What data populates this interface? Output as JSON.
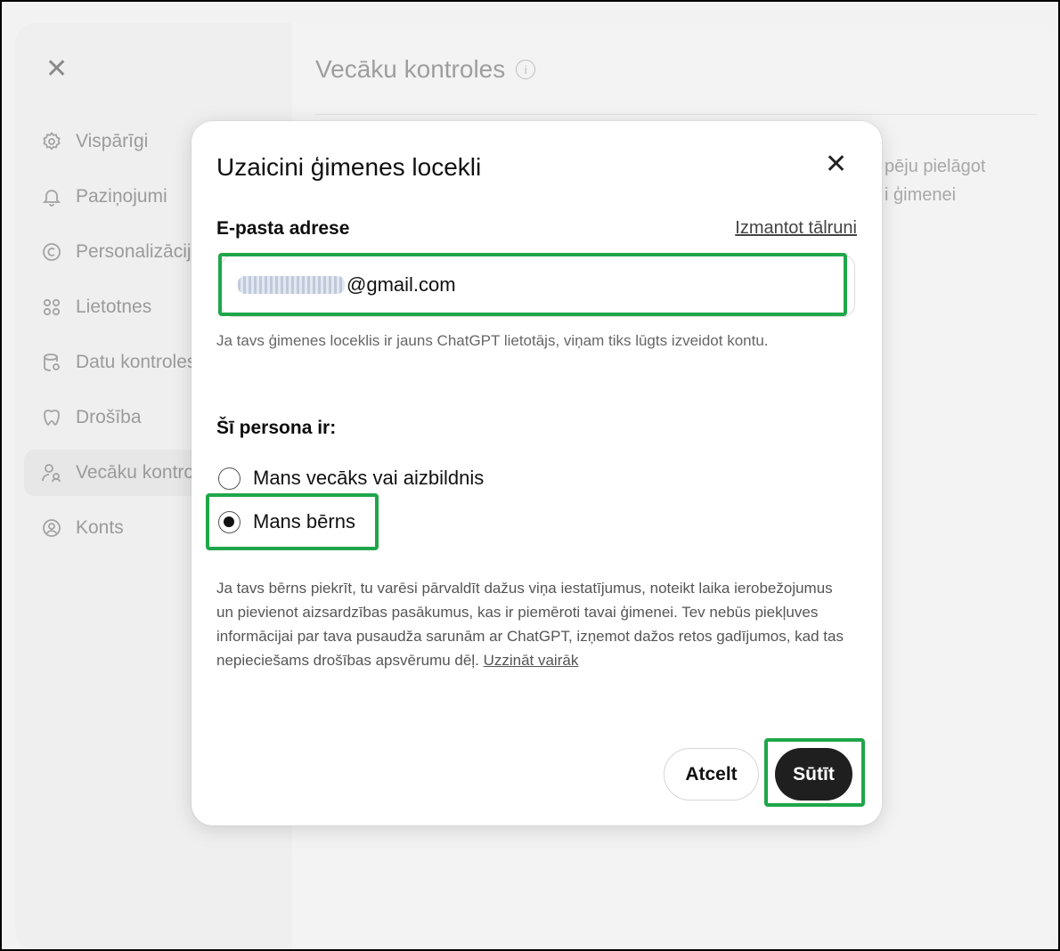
{
  "background": {
    "close_icon": "close-icon",
    "sidebar": {
      "items": [
        {
          "label": "Vispārīgi",
          "icon": "gear-icon",
          "active": false
        },
        {
          "label": "Paziņojumi",
          "icon": "bell-icon",
          "active": false
        },
        {
          "label": "Personalizācija",
          "icon": "personalization-icon",
          "active": false
        },
        {
          "label": "Lietotnes",
          "icon": "apps-grid-icon",
          "active": false
        },
        {
          "label": "Datu kontroles",
          "icon": "database-icon",
          "active": false
        },
        {
          "label": "Drošība",
          "icon": "shield-icon",
          "active": false
        },
        {
          "label": "Vecāku kontroles",
          "icon": "parental-icon",
          "active": true
        },
        {
          "label": "Konts",
          "icon": "account-icon",
          "active": false
        }
      ]
    },
    "main": {
      "title": "Vecāku kontroles",
      "text_line1": "pēju pielāgot",
      "text_line2": "i ģimenei"
    }
  },
  "dialog": {
    "title": "Uzaicini ģimenes locekli",
    "email_label": "E-pasta adrese",
    "use_phone_link": "Izmantot tālruni",
    "email_value_visible": "@gmail.com",
    "email_hint": "Ja tavs ģimenes loceklis ir jauns ChatGPT lietotājs, viņam tiks lūgts izveidot kontu.",
    "persona_label": "Šī persona ir:",
    "options": [
      {
        "label": "Mans vecāks vai aizbildnis",
        "checked": false
      },
      {
        "label": "Mans bērns",
        "checked": true
      }
    ],
    "description": "Ja tavs bērns piekrīt, tu varēsi pārvaldīt dažus viņa iestatījumus, noteikt laika ierobežojumus un pievienot aizsardzības pasākumus, kas ir piemēroti tavai ģimenei. Tev nebūs piekļuves informācijai par tava pusaudža sarunām ar ChatGPT, izņemot dažos retos gadījumos, kad tas nepieciešams drošības apsvērumu dēļ.",
    "learn_more": "Uzzināt vairāk",
    "cancel_button": "Atcelt",
    "send_button": "Sūtīt"
  },
  "colors": {
    "highlight": "#1fa64a",
    "send_button_bg": "#1f1f1f"
  }
}
